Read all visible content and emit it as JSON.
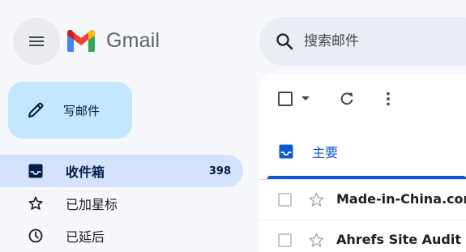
{
  "app": {
    "name": "Gmail"
  },
  "search": {
    "placeholder": "搜索邮件"
  },
  "compose": {
    "label": "写邮件"
  },
  "sidebar": {
    "items": [
      {
        "label": "收件箱",
        "icon": "inbox-icon",
        "count": "398",
        "active": true
      },
      {
        "label": "已加星标",
        "icon": "star-icon",
        "active": false
      },
      {
        "label": "已延后",
        "icon": "clock-icon",
        "active": false
      }
    ]
  },
  "tabs": [
    {
      "label": "主要",
      "icon": "inbox-icon",
      "active": true
    }
  ],
  "emails": [
    {
      "sender": "Made-in-China.com"
    },
    {
      "sender": "Ahrefs Site Audit"
    }
  ],
  "colors": {
    "accent": "#0b57d0",
    "active_nav_bg": "#d3e3fd",
    "compose_bg": "#c2e7ff",
    "search_bg": "#e9eef6",
    "page_bg": "#f6f8fc"
  }
}
